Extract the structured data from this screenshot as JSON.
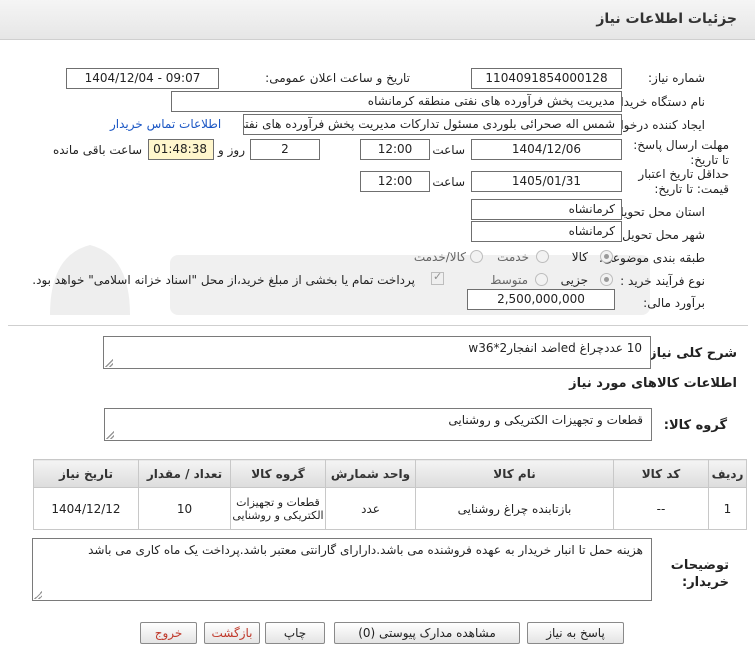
{
  "header": {
    "title": "جزئیات اطلاعات نیاز"
  },
  "fields": {
    "need_number_label": "شماره نیاز:",
    "need_number": "1104091854000128",
    "announce_label": "تاریخ و ساعت اعلان عمومی:",
    "announce_value": "1404/12/04 - 09:07",
    "buyer_label": "نام دستگاه خریدار:",
    "buyer_value": "مدیریت پخش فرآورده های نفتی منطقه کرمانشاه",
    "creator_label": "ایجاد کننده درخواست:",
    "creator_value": "شمس اله صحرائی بلوردی مسئول تدارکات  مدیریت پخش فرآورده های نفتی منط",
    "contact_link": "اطلاعات تماس خریدار",
    "deadline_label": "مهلت ارسال پاسخ: تا تاریخ:",
    "deadline_date": "1404/12/06",
    "time_label": "ساعت",
    "deadline_time": "12:00",
    "days_value": "2",
    "days_label": "روز و",
    "remaining_time": "01:48:38",
    "remaining_label": "ساعت باقی مانده",
    "validity_label": "حداقل تاریخ اعتبار قیمت: تا تاریخ:",
    "validity_date": "1405/01/31",
    "validity_time": "12:00",
    "province_label": "استان محل تحویل:",
    "province_value": "کرمانشاه",
    "city_label": "شهر محل تحویل:",
    "city_value": "کرمانشاه",
    "category_label": "طبقه بندی موضوعی:",
    "category_options": [
      "کالا",
      "خدمت",
      "کالا/خدمت"
    ],
    "process_label": "نوع فرآیند خرید :",
    "process_options": [
      "جزیی",
      "متوسط"
    ],
    "payment_note": "پرداخت تمام یا بخشی از مبلغ خرید،از محل \"اسناد خزانه اسلامی\" خواهد بود.",
    "budget_label": "برآورد مالی:",
    "budget_value": "2,500,000,000"
  },
  "description": {
    "label": "شرح کلی نیاز:",
    "value": "10 عددچراغ ledضد انفجار2*w36"
  },
  "goods_section": {
    "title": "اطلاعات کالاهای مورد نیاز",
    "group_label": "گروه کالا:",
    "group_value": "قطعات و تجهیزات الکتریکی و روشنایی"
  },
  "table": {
    "headers": [
      "ردیف",
      "کد کالا",
      "نام کالا",
      "واحد شمارش",
      "گروه کالا",
      "تعداد / مقدار",
      "تاریخ نیاز"
    ],
    "rows": [
      {
        "row": "1",
        "code": "--",
        "name": "بازتابنده چراغ روشنایی",
        "unit": "عدد",
        "group": "قطعات و تجهیزات الکتریکی و روشنایی",
        "qty": "10",
        "date": "1404/12/12"
      }
    ]
  },
  "buyer_notes": {
    "label": "توضیحات خریدار:",
    "value": "هزینه حمل تا انبار خریدار به عهده فروشنده می باشد.دارارای گارانتی معتبر باشد.پرداخت یک ماه کاری می باشد"
  },
  "buttons": {
    "respond": "پاسخ به نیاز",
    "attachments": "مشاهده مدارک پیوستی (0)",
    "print": "چاپ",
    "back": "بازگشت",
    "exit": "خروج"
  },
  "colors": {
    "link": "#1a56c4",
    "remaining_bg": "#fff6cc",
    "button_red_text": "#c0392b"
  }
}
